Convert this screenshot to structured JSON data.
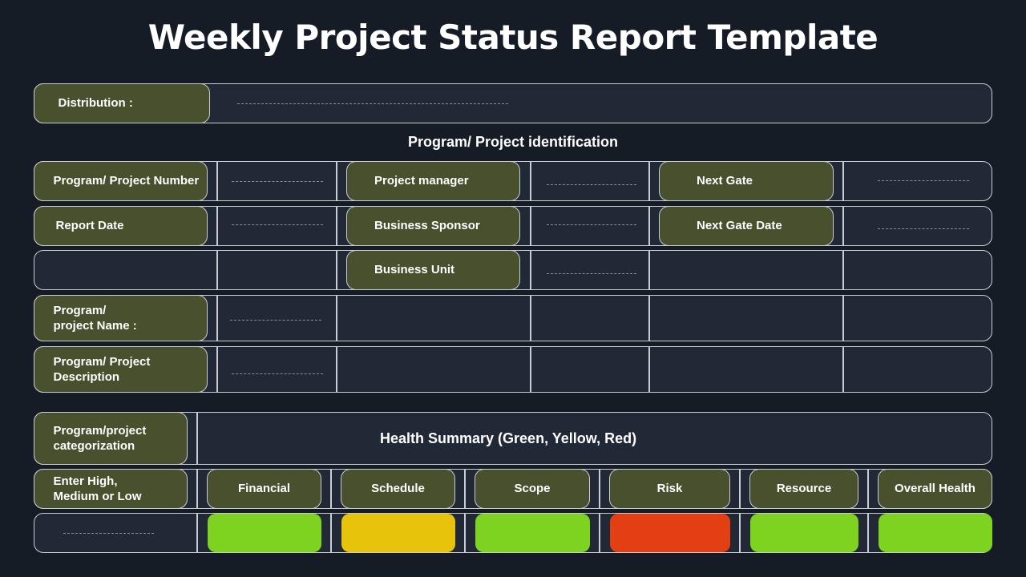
{
  "title": "Weekly Project Status Report Template",
  "distribution": {
    "label": "Distribution :",
    "value": "________________________________"
  },
  "identification": {
    "heading": "Program/ Project identification",
    "rows": [
      {
        "label": "Program/ Project Number",
        "value": "___________",
        "mid_label": "Project manager",
        "mid_value": "___________",
        "right_label": "Next Gate",
        "right_value": "___________"
      },
      {
        "label": "Report Date",
        "value": "___________",
        "mid_label": "Business Sponsor",
        "mid_value": "___________",
        "right_label": "Next Gate Date",
        "right_value": "___________"
      },
      {
        "label": "",
        "value": "",
        "mid_label": "Business Unit",
        "mid_value": "___________"
      },
      {
        "label": "Program/ project Name :",
        "value": "___________"
      },
      {
        "label": "Program/ Project Description",
        "value": "___________"
      }
    ]
  },
  "categorization": {
    "label": "Program/project categorization",
    "health_title": "Health Summary (Green, Yellow, Red)",
    "entry_label": "Enter High, Medium or Low",
    "entry_value": "___________",
    "columns": [
      {
        "label": "Financial",
        "status": "Green",
        "color": "#7ed321"
      },
      {
        "label": "Schedule",
        "status": "Yellow",
        "color": "#e8c30c"
      },
      {
        "label": "Scope",
        "status": "Green",
        "color": "#7ed321"
      },
      {
        "label": "Risk",
        "status": "Red",
        "color": "#e23f12"
      },
      {
        "label": "Resource",
        "status": "Green",
        "color": "#7ed321"
      },
      {
        "label": "Overall Health",
        "status": "Green",
        "color": "#7ed321"
      }
    ]
  },
  "colors": {
    "background": "#161c26",
    "panel": "#212836",
    "label_fill": "#48502d",
    "border": "#c9cdd3"
  }
}
